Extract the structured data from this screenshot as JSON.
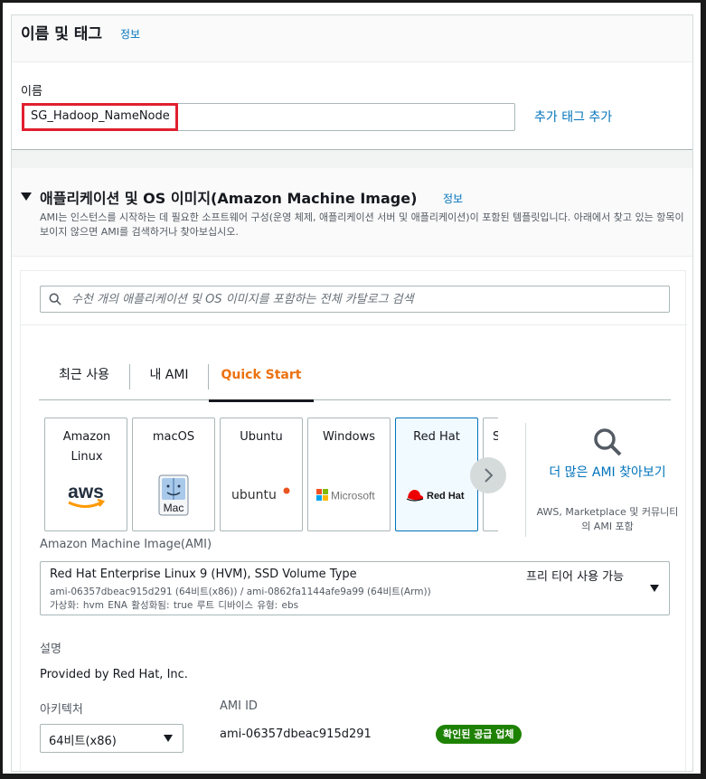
{
  "name_section": {
    "title": "이름 및 태그",
    "info": "정보",
    "name_label": "이름",
    "name_value": "SG_Hadoop_NameNode",
    "add_tag": "추가 태그 추가"
  },
  "ami_section": {
    "title": "애플리케이션 및 OS 이미지(Amazon Machine Image)",
    "info": "정보",
    "description": "AMI는 인스턴스를 시작하는 데 필요한 소프트웨어 구성(운영 체제, 애플리케이션 서버 및 애플리케이션)이 포함된 템플릿입니다. 아래에서 찾고 있는 항목이 보이지 않으면 AMI를 검색하거나 찾아보십시오.",
    "search_placeholder": "수천 개의 애플리케이션 및 OS 이미지를 포함하는 전체 카탈로그 검색",
    "tabs": [
      {
        "label": "최근 사용",
        "active": false
      },
      {
        "label": "내 AMI",
        "active": false
      },
      {
        "label": "Quick Start",
        "active": true
      }
    ],
    "os_cards": [
      {
        "name": "Amazon Linux",
        "logo": "aws",
        "selected": false
      },
      {
        "name": "macOS",
        "logo": "Mac",
        "selected": false
      },
      {
        "name": "Ubuntu",
        "logo": "ubuntu",
        "selected": false
      },
      {
        "name": "Windows",
        "logo": "Microsoft",
        "selected": false
      },
      {
        "name": "Red Hat",
        "logo": "Red Hat",
        "selected": true
      },
      {
        "name": "S",
        "logo": "",
        "selected": false
      }
    ],
    "more_link": "더 많은 AMI 찾아보기",
    "more_sub": "AWS, Marketplace 및 커뮤니티의 AMI 포함",
    "ami_label": "Amazon Machine Image(AMI)",
    "selected_ami": {
      "title": "Red Hat Enterprise Linux 9 (HVM), SSD Volume Type",
      "ids": "ami-06357dbeac915d291 (64비트(x86)) / ami-0862fa1144afe9a99 (64비트(Arm))",
      "props": "가상화: hvm    ENA 활성화됨: true    루트 디바이스 유형: ebs",
      "tier": "프리 티어 사용 가능"
    },
    "desc_label": "설명",
    "desc_value": "Provided by Red Hat, Inc.",
    "arch_label": "아키텍처",
    "arch_value": "64비트(x86)",
    "amiid_label": "AMI ID",
    "amiid_value": "ami-06357dbeac915d291",
    "verified": "확인된 공급 업체"
  },
  "colors": {
    "link": "#0073bb",
    "tab_active": "#ec7211",
    "verified_bg": "#1d8102",
    "highlight": "#e0202e",
    "selected_card_border": "#0073bb"
  },
  "icons": [
    "search-icon",
    "caret-down-icon",
    "chevron-right-icon",
    "aws-logo",
    "mac-logo",
    "ubuntu-logo",
    "microsoft-logo",
    "redhat-logo"
  ]
}
